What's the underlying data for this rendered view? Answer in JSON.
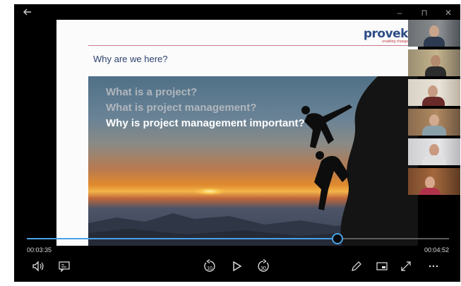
{
  "window": {
    "back_icon": "back-arrow-icon",
    "minimize": "–",
    "maximize": "⊓",
    "close": "✕"
  },
  "slide": {
    "logo_word": "provek",
    "logo_tagline": "enabling change",
    "title": "Why are we here?",
    "questions": [
      "What is a project?",
      "What is project management?",
      "Why is project management important?"
    ],
    "question_colors": [
      "#b0b6bd",
      "#b0b6bd",
      "#ffffff"
    ]
  },
  "participants_count": 6,
  "playback": {
    "elapsed": "00:03:35",
    "duration": "00:04:52",
    "progress": 0.736,
    "skip_back": "10",
    "skip_forward": "30",
    "accent": "#4aa3e6"
  },
  "controls": {
    "volume": "volume-icon",
    "captions": "captions-icon",
    "skip_back": "skip-back-10-icon",
    "play": "play-icon",
    "skip_forward": "skip-forward-30-icon",
    "edit": "pencil-icon",
    "mini_view": "mini-view-icon",
    "fullscreen": "fullscreen-icon",
    "more": "more-options-icon"
  }
}
